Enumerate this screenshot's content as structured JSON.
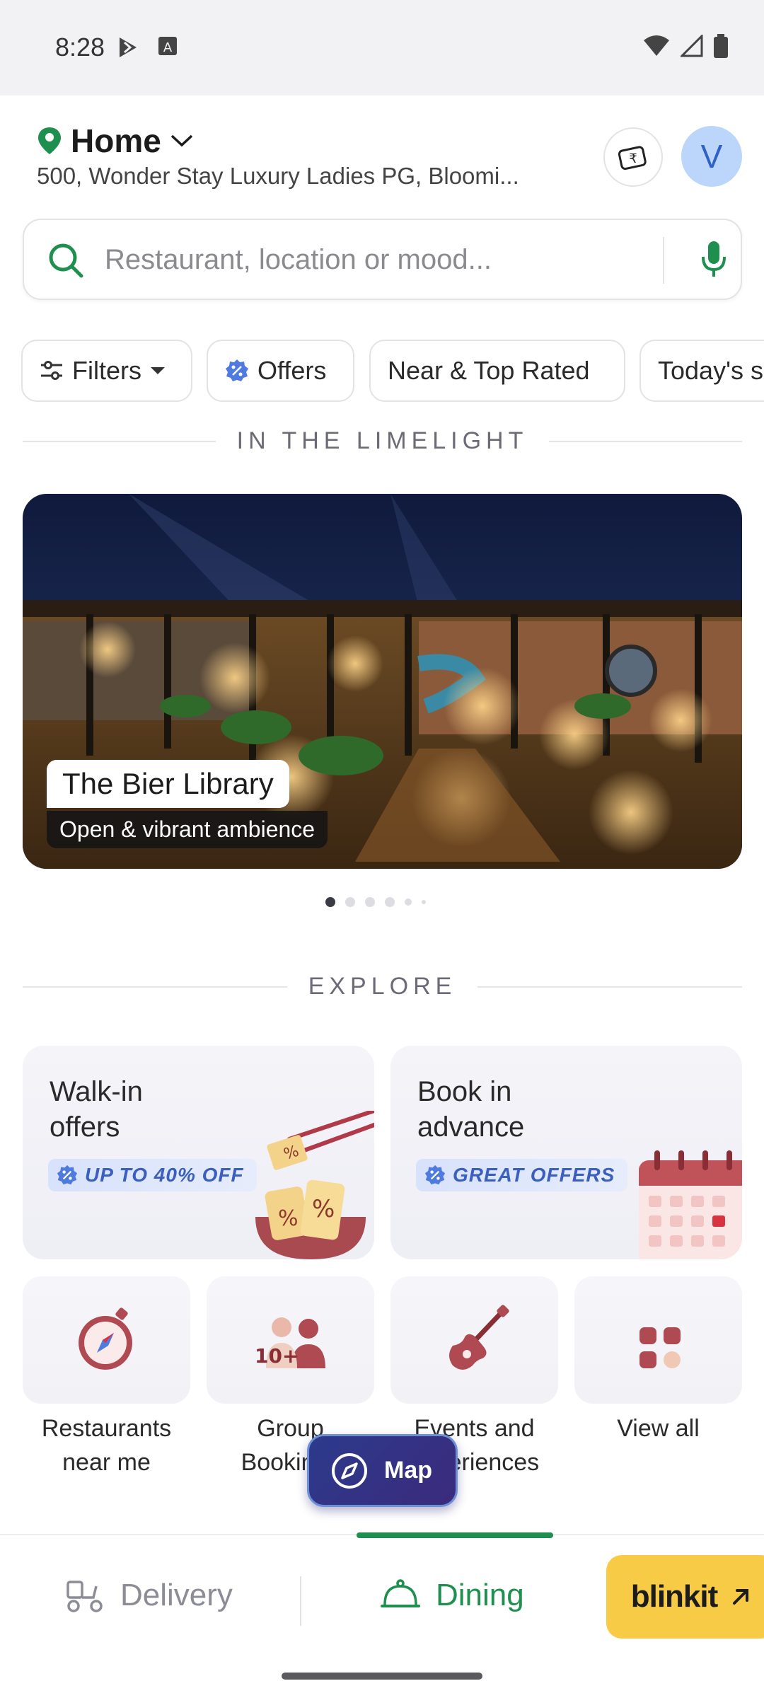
{
  "status_bar": {
    "time": "8:28"
  },
  "header": {
    "location_title": "Home",
    "address": "500, Wonder Stay Luxury Ladies PG, Bloomi...",
    "avatar_letter": "V"
  },
  "search": {
    "placeholder": "Restaurant, location or mood..."
  },
  "chips": [
    {
      "label": "Filters"
    },
    {
      "label": "Offers"
    },
    {
      "label": "Near & Top Rated"
    },
    {
      "label": "Today's specials"
    }
  ],
  "limelight": {
    "section_title": "IN THE LIMELIGHT",
    "name": "The Bier Library",
    "subtitle": "Open & vibrant ambience",
    "slide_count": 6,
    "active_slide": 1
  },
  "explore": {
    "section_title": "EXPLORE",
    "cards": [
      {
        "title": "Walk-in\noffers",
        "badge": "UP TO 40% OFF"
      },
      {
        "title": "Book in\nadvance",
        "badge": "GREAT OFFERS"
      }
    ],
    "tiles": [
      {
        "label": "Restaurants\nnear me",
        "icon": "compass-icon"
      },
      {
        "label": "Group\nBookings",
        "icon": "group-icon"
      },
      {
        "label": "Events and\nexperiences",
        "icon": "guitar-icon"
      },
      {
        "label": "View all",
        "icon": "grid-icon"
      }
    ]
  },
  "map_button": {
    "label": "Map"
  },
  "bottom_nav": {
    "delivery": "Delivery",
    "dining": "Dining",
    "blinkit": "blinkit"
  },
  "colors": {
    "accent_green": "#1e8f4e",
    "offer_blue": "#3a5fbf",
    "accent_maroon": "#b04a52",
    "blinkit_yellow": "#f8cb46"
  }
}
